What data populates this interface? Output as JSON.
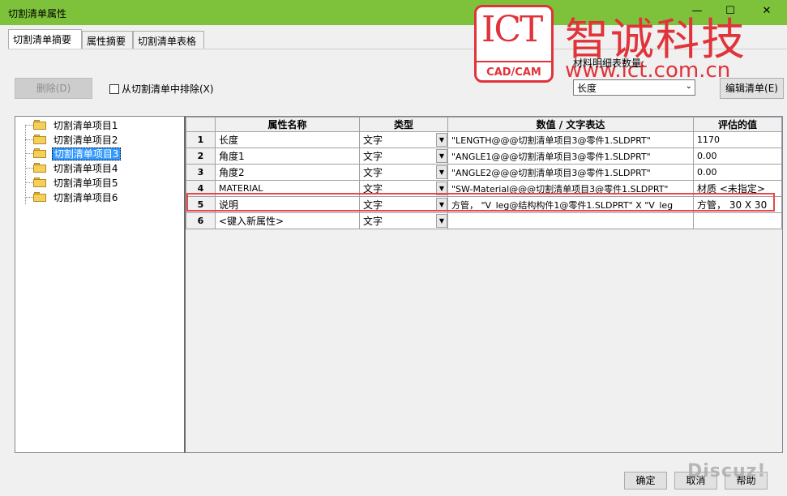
{
  "window": {
    "title": "切割清单属性"
  },
  "tabs": [
    {
      "label": "切割清单摘要",
      "active": true
    },
    {
      "label": "属性摘要",
      "active": false
    },
    {
      "label": "切割清单表格",
      "active": false
    }
  ],
  "toolbar": {
    "delete_label": "删除(D)",
    "exclude_label": "从切割清单中排除(X)",
    "exclude_checked": false,
    "qty_label": "材料明细表数量:",
    "qty_select_value": "长度",
    "edit_list_label": "编辑清单(E)"
  },
  "tree": {
    "items": [
      {
        "label": "切割清单项目1",
        "selected": false
      },
      {
        "label": "切割清单项目2",
        "selected": false
      },
      {
        "label": "切割清单项目3",
        "selected": true
      },
      {
        "label": "切割清单项目4",
        "selected": false
      },
      {
        "label": "切割清单项目5",
        "selected": false
      },
      {
        "label": "切割清单项目6",
        "selected": false
      }
    ]
  },
  "grid": {
    "headers": [
      "属性名称",
      "类型",
      "数值 / 文字表达",
      "评估的值"
    ],
    "rows": [
      {
        "num": "1",
        "name": "长度",
        "type": "文字",
        "expr": "\"LENGTH@@@切割清单项目3@零件1.SLDPRT\"",
        "value": "1170"
      },
      {
        "num": "2",
        "name": "角度1",
        "type": "文字",
        "expr": "\"ANGLE1@@@切割清单项目3@零件1.SLDPRT\"",
        "value": "0.00"
      },
      {
        "num": "3",
        "name": "角度2",
        "type": "文字",
        "expr": "\"ANGLE2@@@切割清单项目3@零件1.SLDPRT\"",
        "value": "0.00"
      },
      {
        "num": "4",
        "name": "MATERIAL",
        "type": "文字",
        "expr": "\"SW-Material@@@切割清单项目3@零件1.SLDPRT\"",
        "value": "材质 <未指定>"
      },
      {
        "num": "5",
        "name": "说明",
        "type": "文字",
        "expr": "方管， \"V_leg@结构构件1@零件1.SLDPRT\" X \"V_leg",
        "value": "方管， 30 X 30"
      },
      {
        "num": "6",
        "name": "<键入新属性>",
        "type": "文字",
        "expr": "",
        "value": ""
      }
    ]
  },
  "footer": {
    "ok_label": "确定",
    "cancel_label": "取消",
    "help_label": "帮助"
  },
  "logo": {
    "ict": "ICT",
    "cadcam": "CAD/CAM",
    "cn_name": "智诚科技",
    "url": "www.ict.com.cn"
  },
  "watermark": "Discuz!"
}
